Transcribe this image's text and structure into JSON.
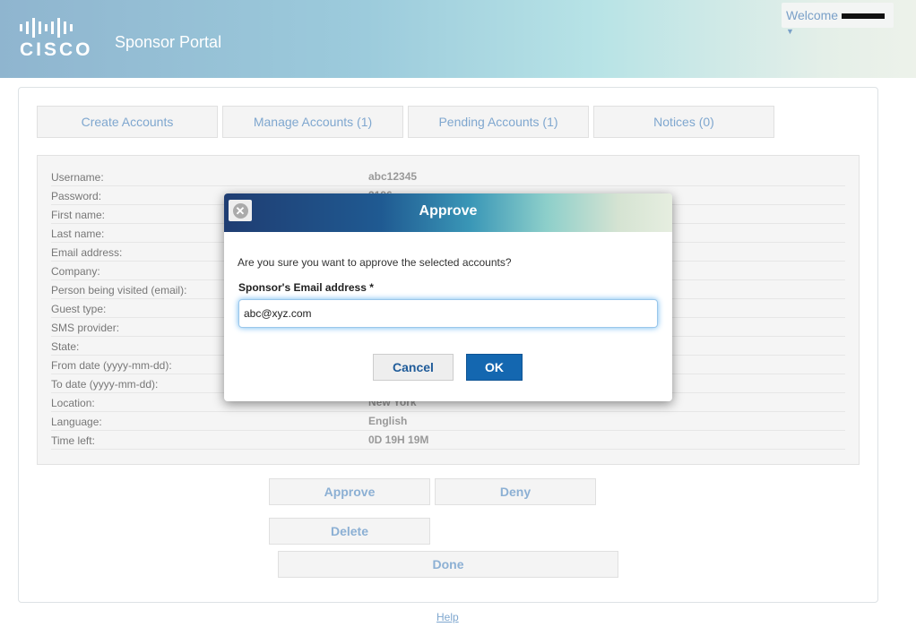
{
  "header": {
    "logo_text": "CISCO",
    "title": "Sponsor Portal",
    "welcome": "Welcome"
  },
  "tabs": [
    {
      "label": "Create Accounts"
    },
    {
      "label": "Manage Accounts (1)"
    },
    {
      "label": "Pending Accounts (1)"
    },
    {
      "label": "Notices (0)"
    }
  ],
  "details": [
    {
      "label": "Username:",
      "value": "abc12345"
    },
    {
      "label": "Password:",
      "value": "3196"
    },
    {
      "label": "First name:",
      "value": ""
    },
    {
      "label": "Last name:",
      "value": ""
    },
    {
      "label": "Email address:",
      "value": ""
    },
    {
      "label": "Company:",
      "value": ""
    },
    {
      "label": "Person being visited (email):",
      "value": ""
    },
    {
      "label": "Guest type:",
      "value": ""
    },
    {
      "label": "SMS provider:",
      "value": ""
    },
    {
      "label": "State:",
      "value": ""
    },
    {
      "label": "From date (yyyy-mm-dd):",
      "value": ""
    },
    {
      "label": "To date (yyyy-mm-dd):",
      "value": ""
    },
    {
      "label": "Location:",
      "value": "New York"
    },
    {
      "label": "Language:",
      "value": "English"
    },
    {
      "label": "Time left:",
      "value": "0D 19H 19M"
    }
  ],
  "actions": {
    "approve": "Approve",
    "deny": "Deny",
    "delete": "Delete",
    "done": "Done"
  },
  "help": "Help",
  "dialog": {
    "title": "Approve",
    "question": "Are you sure you want to approve the selected accounts?",
    "email_label": "Sponsor's Email address *",
    "email_value": "abc@xyz.com",
    "cancel": "Cancel",
    "ok": "OK"
  }
}
